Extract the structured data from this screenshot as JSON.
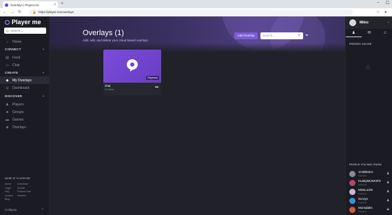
{
  "browser": {
    "tab_title": "Overlays | Player.me",
    "tab_close": "×",
    "new_tab": "+",
    "url": "https://player.me/overlays",
    "controls": [
      "–",
      "☐"
    ]
  },
  "sidebar": {
    "logo": "Player me",
    "search_placeholder": "Q, Search...",
    "home": "Home",
    "connect": "CONNECT",
    "feed": "Feed",
    "chat": "Chat",
    "create": "CREATE",
    "my_overlays": "My Overlays",
    "dashboard": "Dashboard",
    "discover": "DISCOVER",
    "players": "Players",
    "groups": "Groups",
    "games": "Games",
    "overlays": "Overlays",
    "more_heading": "MORE AT PLAYER.ME",
    "footer_links": [
      "About",
      "Download",
      "Legal",
      "Arcade",
      "FAQ",
      "Feature Vote",
      "Contact",
      "Partners",
      "Blog"
    ],
    "collapse": "Collapse"
  },
  "main": {
    "title": "Overlays (1)",
    "subtitle": "Add, edit, and delete your cloud based overlays",
    "add_button": "Add Overlay",
    "search_placeholder": "Search...",
    "overlays": [
      {
        "title": "chat",
        "status": "In Game",
        "tag": "Playerme"
      }
    ]
  },
  "right": {
    "profile_name": "Mileo",
    "friends_online": "FRIENDS ONLINE",
    "people_heading": "PEOPLE YOU MAY KNOW",
    "people": [
      {
        "name": "1CMilestro",
        "sub": "Featured",
        "color": "#8a8b96"
      },
      {
        "name": "HuskyMUDKIPZ",
        "sub": "Featured",
        "color": "#b0486a"
      },
      {
        "name": "MissLudiin",
        "sub": "Featured",
        "color": "#c8b8d0"
      },
      {
        "name": "Scoryn",
        "sub": "Featured",
        "color": "#3a8fd0"
      },
      {
        "name": "Monsdalrs",
        "sub": "Featured",
        "color": "#d05a3a"
      }
    ]
  },
  "colors": {
    "accent": "#7c5cd6",
    "status_green": "#3fbf5f"
  }
}
